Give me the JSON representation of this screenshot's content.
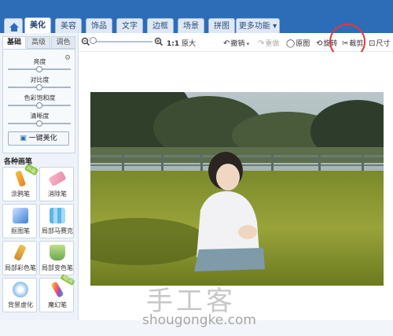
{
  "tabs": {
    "home_icon": "home-icon",
    "items": [
      {
        "label": "美化"
      },
      {
        "label": "美容"
      },
      {
        "label": "饰品"
      },
      {
        "label": "文字"
      },
      {
        "label": "边框"
      },
      {
        "label": "场景"
      },
      {
        "label": "拼图"
      },
      {
        "label": "更多功能 ▾"
      }
    ]
  },
  "toolbar": {
    "zoom_value": "1:1",
    "zoom_label": "原大",
    "undo_label": "撤销",
    "redo_label": "重做",
    "original_label": "原图",
    "rotate_label": "旋转",
    "crop_label": "裁剪",
    "size_label": "尺寸"
  },
  "left": {
    "subtabs": [
      "基础",
      "高级",
      "调色"
    ],
    "sliders": [
      {
        "label": "亮度",
        "value": 0.5
      },
      {
        "label": "对比度",
        "value": 0.5
      },
      {
        "label": "色彩饱和度",
        "value": 0.5
      },
      {
        "label": "清晰度",
        "value": 0.5
      }
    ],
    "one_click_label": "一键美化",
    "brush_title": "各种画笔",
    "tools": [
      {
        "label": "涂鸦笔",
        "icon": "pencil-icon",
        "badge": "升级"
      },
      {
        "label": "消除笔",
        "icon": "eraser-icon",
        "badge": ""
      },
      {
        "label": "抠图笔",
        "icon": "cutout-pen-icon",
        "badge": ""
      },
      {
        "label": "局部马赛克",
        "icon": "mosaic-icon",
        "badge": ""
      },
      {
        "label": "局部彩色笔",
        "icon": "color-brush-icon",
        "badge": ""
      },
      {
        "label": "局部变色笔",
        "icon": "paint-bucket-icon",
        "badge": ""
      },
      {
        "label": "背景虚化",
        "icon": "blur-icon",
        "badge": ""
      },
      {
        "label": "魔幻笔",
        "icon": "magic-pen-icon",
        "badge": "NEW"
      }
    ]
  },
  "watermark": {
    "cn": "手工客",
    "url": "shougongke.com"
  },
  "colors": {
    "topbar": "#2d6db8",
    "highlight_circle": "#e03a3a"
  }
}
